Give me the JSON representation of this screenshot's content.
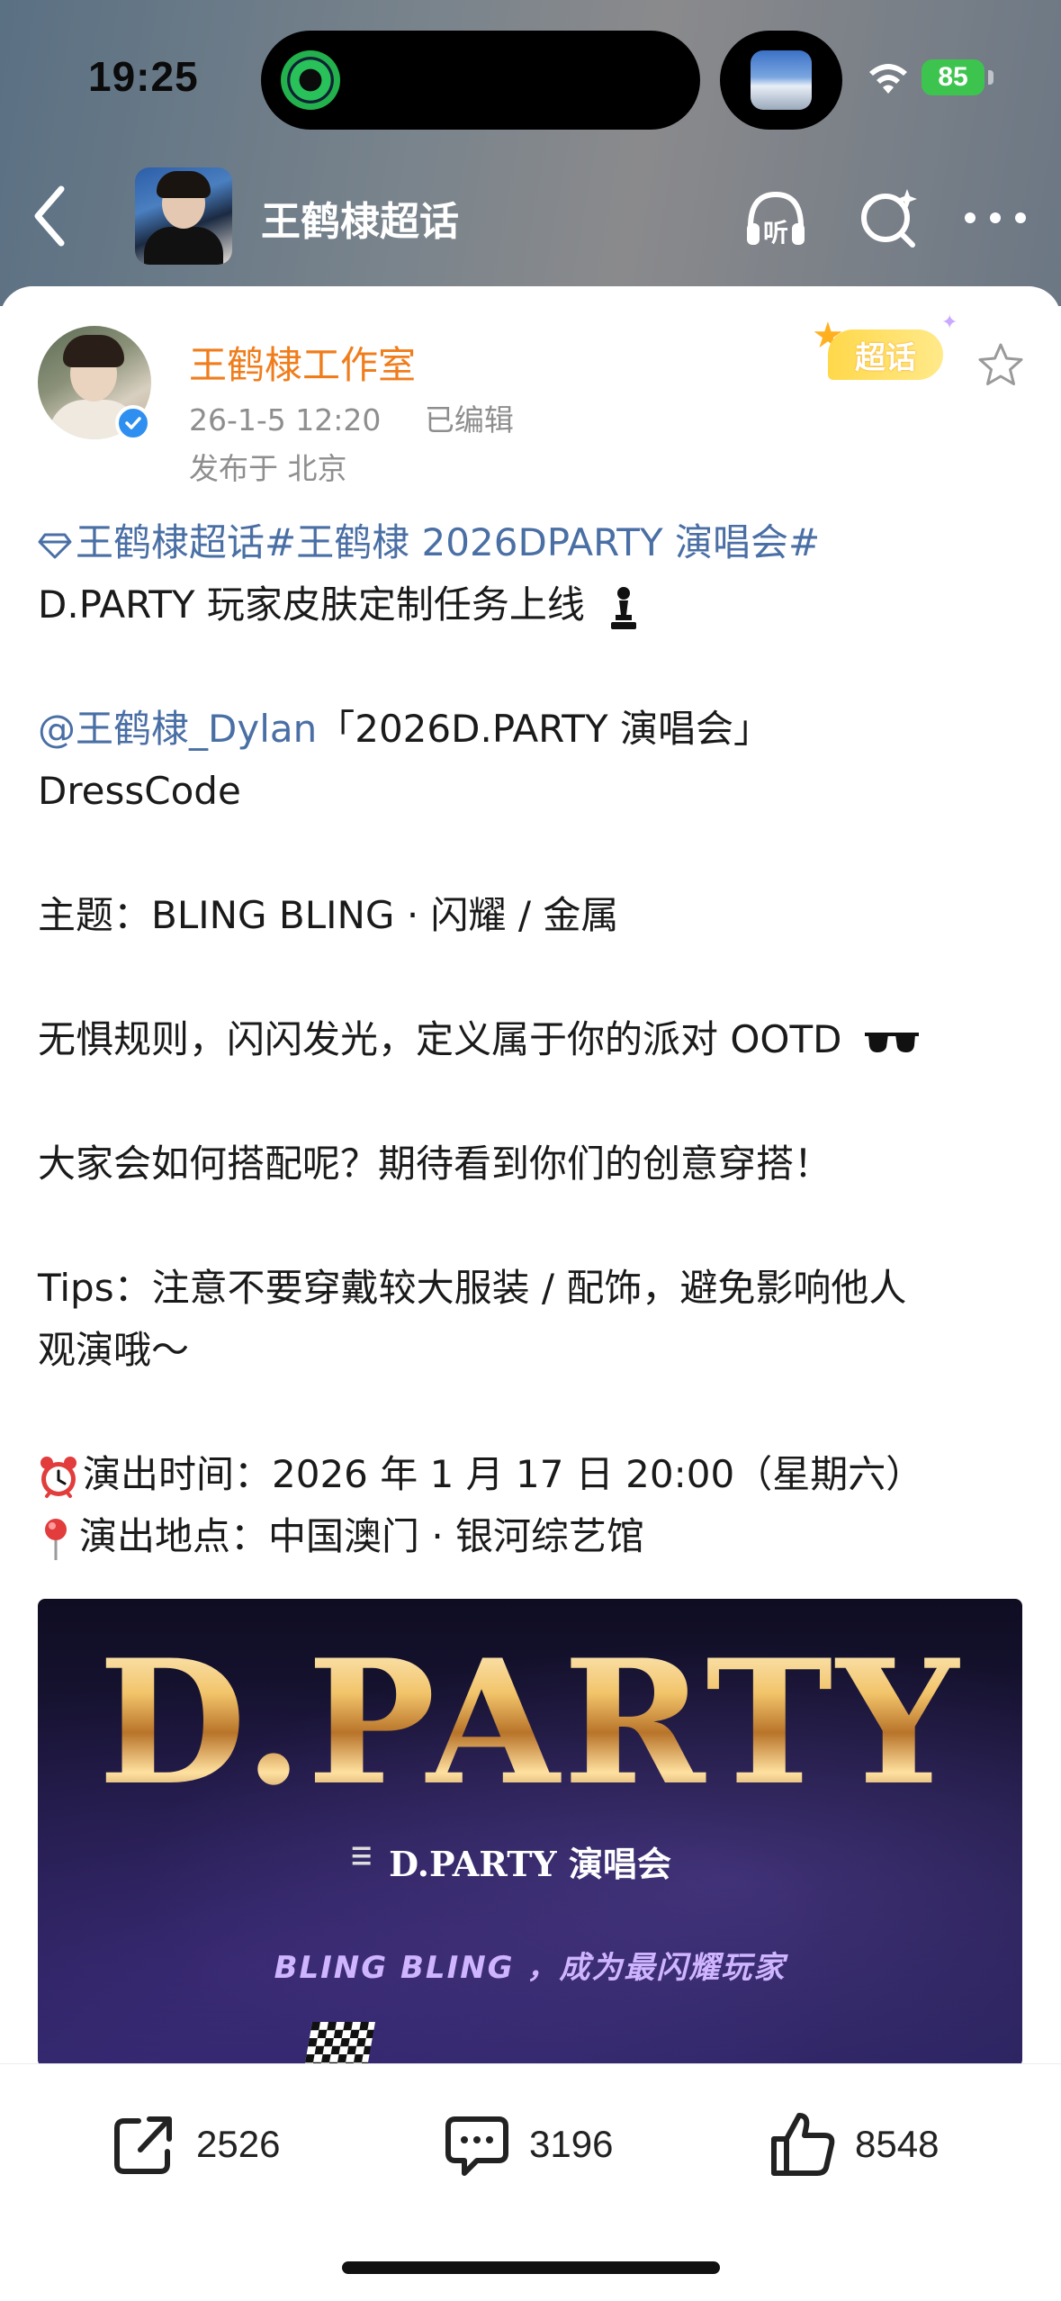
{
  "status_bar": {
    "time": "19:25",
    "battery": "85",
    "battery_color": "#3dc44f"
  },
  "nav": {
    "title": "王鹤棣超话",
    "icons": [
      "back-icon",
      "listen-icon",
      "search-sparkle-icon",
      "more-icon"
    ],
    "listen_label": "听"
  },
  "post_header": {
    "author": "王鹤棣工作室",
    "author_color": "#f07d1c",
    "date": "26-1-5 12:20",
    "edited": "已编辑",
    "location": "发布于 北京",
    "badge": "超话"
  },
  "post": {
    "topic_1": "王鹤棣超话",
    "topic_2": "#王鹤棣 2026DPARTY 演唱会#",
    "line_1": "D.PARTY 玩家皮肤定制任务上线",
    "mention": "@王鹤棣_Dylan",
    "line_2_rest": "「2026D.PARTY 演唱会」",
    "line_3": "DressCode",
    "line_4": "主题：BLING BLING · 闪耀 / 金属",
    "line_5": "无惧规则，闪闪发光，定义属于你的派对 OOTD",
    "line_6": "大家会如何搭配呢？期待看到你们的创意穿搭！",
    "line_7a": "Tips：注意不要穿戴较大服装 / 配饰，避免影响他人",
    "line_7b": "观演哦～",
    "line_8": "演出时间：2026 年 1 月 17 日 20:00（星期六）",
    "line_9": "演出地点：中国澳门 · 银河综艺馆",
    "link_color": "#4a6fa5"
  },
  "poster": {
    "title": "D.PARTY",
    "subtitle": "D.PARTY 演唱会",
    "tagline": "BLING BLING ，成为最闪耀玩家"
  },
  "actions": {
    "shares": "2526",
    "comments": "3196",
    "likes": "8548"
  }
}
